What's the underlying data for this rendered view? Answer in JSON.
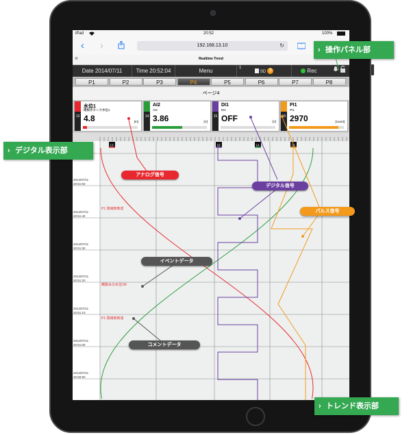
{
  "device": {
    "status_left": "iPad",
    "status_wifi": "wifi-icon",
    "clock": "20:52",
    "battery": "100%"
  },
  "browser": {
    "url": "192.168.13.10",
    "page_title": "Realtime Trend",
    "close_label": "⊗"
  },
  "toolbar": {
    "date": "Date 2014/07/11",
    "time": "Time 20:52:04",
    "menu": "Menu",
    "num_label": "1",
    "sd_label": "SD",
    "help_label": "?",
    "rec_label": "Rec"
  },
  "tabs": [
    {
      "label": "P1",
      "active": false
    },
    {
      "label": "P2",
      "active": false
    },
    {
      "label": "P3",
      "active": false
    },
    {
      "label": "P4",
      "active": true
    },
    {
      "label": "P5",
      "active": false
    },
    {
      "label": "P6",
      "active": false
    },
    {
      "label": "P7",
      "active": false
    },
    {
      "label": "P8",
      "active": false
    }
  ],
  "page_label": "ページ4",
  "channels": [
    {
      "num": "13",
      "name": "水位1",
      "subname": "精製水タンク水位1",
      "value": "4.8",
      "unit": "[m]",
      "color": "#e8282e",
      "level": 0.08
    },
    {
      "num": "14",
      "name": "AI2",
      "subname": "AI2",
      "value": "3.86",
      "unit": "[V]",
      "color": "#2a9d3a",
      "level": 0.55
    },
    {
      "num": "15",
      "name": "DI1",
      "subname": "DI1",
      "value": "OFF",
      "unit": "[V]",
      "color": "#6b3fa0",
      "level": 0.0
    },
    {
      "num": "16",
      "name": "PI1",
      "subname": "PI1",
      "value": "2970",
      "unit": "[count]",
      "color": "#f39a1c",
      "level": 0.9
    }
  ],
  "trend": {
    "markers": [
      "13",
      "15",
      "14",
      "16"
    ],
    "timestamps": [
      [
        "2014/07/11",
        "20:51:50"
      ],
      [
        "2014/07/11",
        "20:51:40"
      ],
      [
        "2014/07/11",
        "20:51:30"
      ],
      [
        "2014/07/11",
        "20:51:20"
      ],
      [
        "2014/07/11",
        "20:51:10"
      ],
      [
        "2014/07/11",
        "20:51:00"
      ],
      [
        "2014/07/11",
        "20:50:50"
      ],
      [
        "2014/07/11",
        "20:50:40"
      ]
    ],
    "comments": [
      "P1 境域到到達",
      "精製水の水位OK",
      "P1 境域到到達"
    ]
  },
  "callouts": {
    "analog": "アナログ信号",
    "digital": "デジタル信号",
    "pulse": "パルス信号",
    "event": "イベントデータ",
    "comment": "コメントデータ"
  },
  "section_labels": {
    "control_panel": "操作パネル部",
    "digital_display": "デジタル表示部",
    "trend_display": "トレンド表示部"
  },
  "colors": {
    "analog": "#e8282e",
    "ai": "#2a9d3a",
    "digital": "#6b3fa0",
    "pulse": "#f39a1c",
    "section_green": "#35a852"
  }
}
